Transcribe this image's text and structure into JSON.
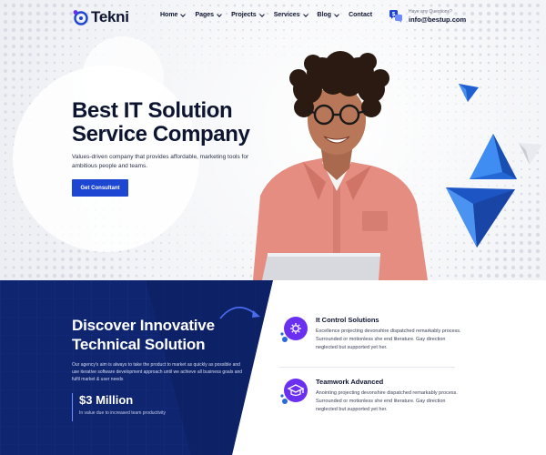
{
  "header": {
    "logo_text": "Tekni",
    "nav": [
      {
        "label": "Home",
        "has_dropdown": true
      },
      {
        "label": "Pages",
        "has_dropdown": true
      },
      {
        "label": "Projects",
        "has_dropdown": true
      },
      {
        "label": "Services",
        "has_dropdown": true
      },
      {
        "label": "Blog",
        "has_dropdown": true
      },
      {
        "label": "Contact",
        "has_dropdown": false
      }
    ],
    "contact": {
      "question": "Have any Questions?",
      "email": "info@bestup.com",
      "icon": "chat-dollar-icon"
    }
  },
  "hero": {
    "title_line1": "Best IT Solution",
    "title_line2": "Service Company",
    "description": "Values-driven company that provides affordable, marketing tools for ambitious people and teams.",
    "cta_label": "Get Consultant"
  },
  "discover": {
    "title_line1": "Discover Innovative",
    "title_line2": "Technical Solution",
    "description": "Our agency's aim is always to take the product to market as quickly as possible and use iterative software development approach until we achieve all business goals and fulfil market & user needs",
    "stat_value": "$3 Million",
    "stat_label": "In value due to increased team productivity"
  },
  "features": [
    {
      "title": "It Control Solutions",
      "description": "Excellence projecting devonshire dispatched remarkably process. Surrounded or motionless she end literature. Gay direction neglected but supported yet her.",
      "icon": "network-gear-icon"
    },
    {
      "title": "Teamwork Advanced",
      "description": "Anointing projecting devonshire dispatched remarkably process. Surrounded or motionless she end literature. Gay direction neglected but supported yet her.",
      "icon": "graduation-cap-icon"
    }
  ],
  "colors": {
    "navy": "#0d1530",
    "primary_blue": "#1d46d2",
    "dark_panel": "#0f2570",
    "purple_icon": "#6a2ff0",
    "accent_blue": "#2a6ad8"
  }
}
